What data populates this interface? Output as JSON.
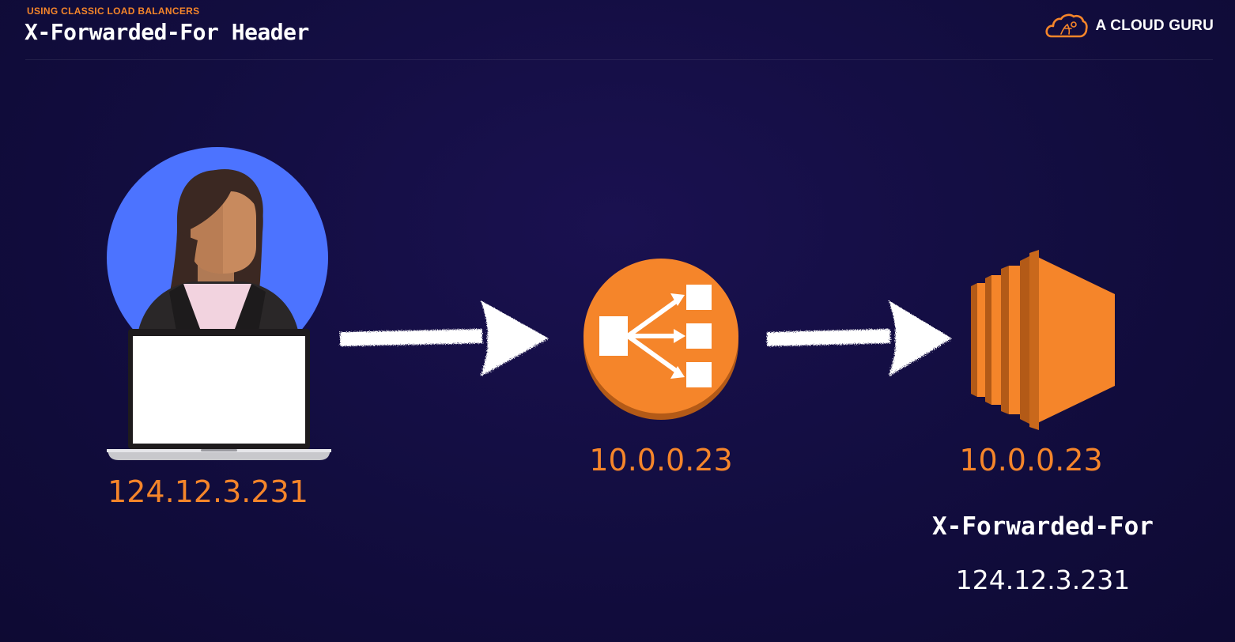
{
  "header": {
    "eyebrow": "USING CLASSIC LOAD BALANCERS",
    "title": "X-Forwarded-For Header",
    "brand_name": "A CLOUD GURU",
    "brand_logo_icon": "cloud-logo-icon"
  },
  "diagram": {
    "client": {
      "icon": "user-with-laptop-icon",
      "ip": "124.12.3.231"
    },
    "load_balancer": {
      "icon": "classic-load-balancer-icon",
      "ip": "10.0.0.23"
    },
    "server": {
      "icon": "ec2-instance-icon",
      "ip": "10.0.0.23"
    },
    "header_name": "X-Forwarded-For",
    "header_value": "124.12.3.231",
    "arrows": [
      {
        "from": "client",
        "to": "load_balancer",
        "icon": "right-arrow-icon"
      },
      {
        "from": "load_balancer",
        "to": "server",
        "icon": "right-arrow-icon"
      }
    ]
  },
  "colors": {
    "background": "#120d3f",
    "accent_orange": "#f5852a",
    "avatar_blue": "#4c73ff",
    "text_white": "#ffffff"
  }
}
